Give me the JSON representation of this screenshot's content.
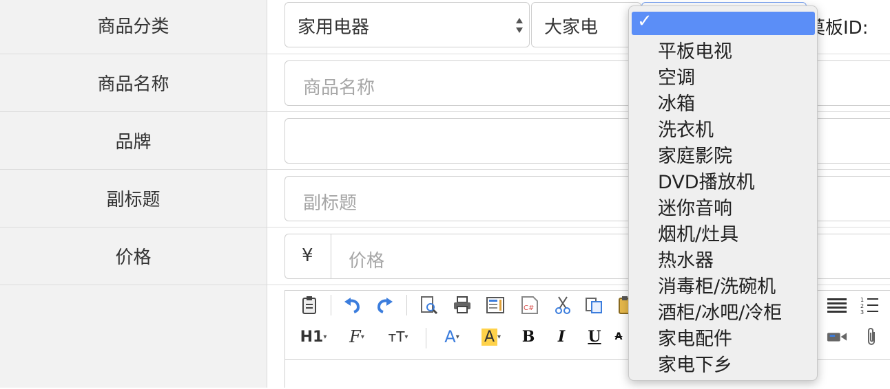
{
  "labels": {
    "category": "商品分类",
    "name": "商品名称",
    "brand": "品牌",
    "subtitle": "副标题",
    "price": "价格"
  },
  "category": {
    "level1": "家用电器",
    "level2": "大家电",
    "template_id_label": "模板ID:",
    "template_id_partial": "莫板ID:"
  },
  "inputs": {
    "name_placeholder": "商品名称",
    "brand_value": "",
    "subtitle_placeholder": "副标题",
    "currency_symbol": "¥",
    "price_placeholder": "价格"
  },
  "dropdown": {
    "checkmark": "✓",
    "selected_value": "",
    "options": [
      "平板电视",
      "空调",
      "冰箱",
      "洗衣机",
      "家庭影院",
      "DVD播放机",
      "迷你音响",
      "烟机/灶具",
      "热水器",
      "消毒柜/洗碗机",
      "酒柜/冰吧/冷柜",
      "家电配件",
      "家电下乡"
    ]
  },
  "toolbar": {
    "heading_label": "H1",
    "font_label": "F",
    "size_label": "тT",
    "bold_label": "B",
    "italic_label": "I",
    "underline_label": "U",
    "code_label": "C#",
    "colors": {
      "accent_blue": "#3b7ddd",
      "highlight_yellow": "#ffd24a",
      "dropdown_selected": "#5b8ef7"
    }
  }
}
